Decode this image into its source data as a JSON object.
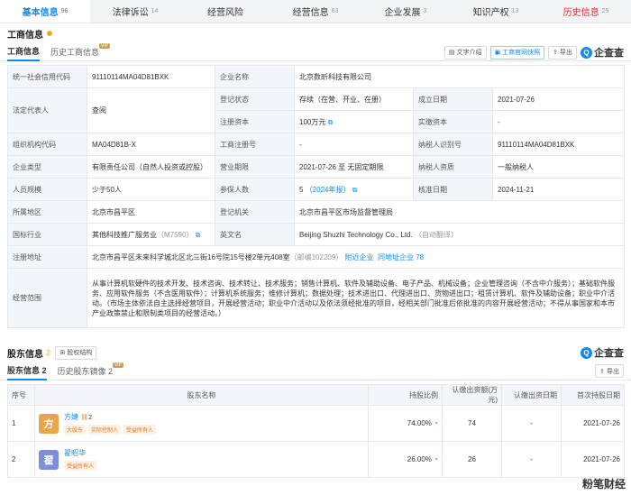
{
  "topnav": [
    {
      "label": "基本信息",
      "count": "96"
    },
    {
      "label": "法律诉讼",
      "count": "14"
    },
    {
      "label": "经营风险",
      "count": ""
    },
    {
      "label": "经营信息",
      "count": "63"
    },
    {
      "label": "企业发展",
      "count": "3"
    },
    {
      "label": "知识产权",
      "count": "13"
    },
    {
      "label": "历史信息",
      "count": "25"
    }
  ],
  "business": {
    "title": "工商信息",
    "tab_current": "工商信息",
    "tab_history": "历史工商信息",
    "vip": "VIP",
    "btn_text": "文字介绍",
    "btn_site": "工商官网快照",
    "btn_export": "导出",
    "logo": "企查查"
  },
  "rows": {
    "credit_code_label": "统一社会信用代码",
    "credit_code": "91110114MA04D81BXK",
    "company_name_label": "企业名称",
    "company_name": "北京数昕科技有限公司",
    "legal_rep_label": "法定代表人",
    "legal_rep": "查阅",
    "reg_status_label": "登记状态",
    "reg_status": "存续（在营、开业、在册）",
    "est_date_label": "成立日期",
    "est_date": "2021-07-26",
    "reg_capital_label": "注册资本",
    "reg_capital": "100万元",
    "paid_capital_label": "实缴资本",
    "paid_capital": "-",
    "org_code_label": "组织机构代码",
    "org_code": "MA04D81B-X",
    "biz_reg_no_label": "工商注册号",
    "biz_reg_no": "-",
    "taxpayer_id_label": "纳税人识别号",
    "taxpayer_id": "91110114MA04D81BXK",
    "company_type_label": "企业类型",
    "company_type": "有限责任公司（自然人投资或控股）",
    "biz_term_label": "营业期限",
    "biz_term": "2021-07-26 至 无固定期限",
    "taxpayer_qual_label": "纳税人资质",
    "taxpayer_qual": "一般纳税人",
    "staff_size_label": "人员规模",
    "staff_size": "少于50人",
    "insured_label": "参保人数",
    "insured": "5",
    "insured_year": "（2024年报）",
    "approve_date_label": "核准日期",
    "approve_date": "2024-11-21",
    "region_label": "所属地区",
    "region": "北京市昌平区",
    "reg_authority_label": "登记机关",
    "reg_authority": "北京市昌平区市场监督管理局",
    "industry_label": "国标行业",
    "industry": "其他科技推广服务业",
    "industry_code": "（M7590）",
    "english_name_label": "英文名",
    "english_name": "Beijing Shuzhi Technology Co., Ltd.",
    "english_name_note": "（自动翻译）",
    "address_label": "注册地址",
    "address": "北京市昌平区未来科学城北区北三街16号院15号楼2单元408室",
    "postcode": "（邮编102209）",
    "nearby": "附近企业",
    "same_address": "同地址企业 78",
    "scope_label": "经营范围",
    "scope": "从事计算机软硬件的技术开发、技术咨询、技术转让、技术服务；销售计算机、软件及辅助设备、电子产品、机械设备；企业管理咨询（不含中介服务）；基础软件服务、应用软件服务（不含医用软件）；计算机系统服务；维修计算机；数据处理；技术进出口、代理进出口、货物进出口；租赁计算机、软件及辅助设备；职业中介活动。（市场主体依法自主选择经营项目，开展经营活动；职业中介活动以及依法须经批准的项目，经相关部门批准后依批准的内容开展经营活动；不得从事国家和本市产业政策禁止和限制类项目的经营活动。）"
  },
  "shareholder": {
    "title": "股东信息",
    "count": "2",
    "equity_btn": "股权结构",
    "tab_current": "股东信息 2",
    "tab_history": "历史股东镜像 2",
    "vip": "VIP",
    "btn_export": "导出",
    "logo": "企查查",
    "headers": [
      "序号",
      "股东名称",
      "持股比例",
      "认缴出资额(万元)",
      "认缴出资日期",
      "首次持股日期"
    ],
    "list": [
      {
        "no": "1",
        "avatar": "方",
        "name": "方婕",
        "badge": "2",
        "tags": [
          "大股东",
          "实际控制人",
          "受益所有人"
        ],
        "ratio": "74.00%",
        "amount": "74",
        "date": "-",
        "first": "2021-07-26"
      },
      {
        "no": "2",
        "avatar": "翟",
        "name": "翟昭华",
        "badge": "",
        "tags": [
          "受益所有人"
        ],
        "ratio": "26.00%",
        "amount": "26",
        "date": "-",
        "first": "2021-07-26"
      }
    ]
  },
  "watermark": "粉笔财经",
  "colors": {
    "accent": "#128bed",
    "label_bg": "#f2f6fb",
    "history": "#f5222d",
    "vip": "#c6a15b"
  }
}
